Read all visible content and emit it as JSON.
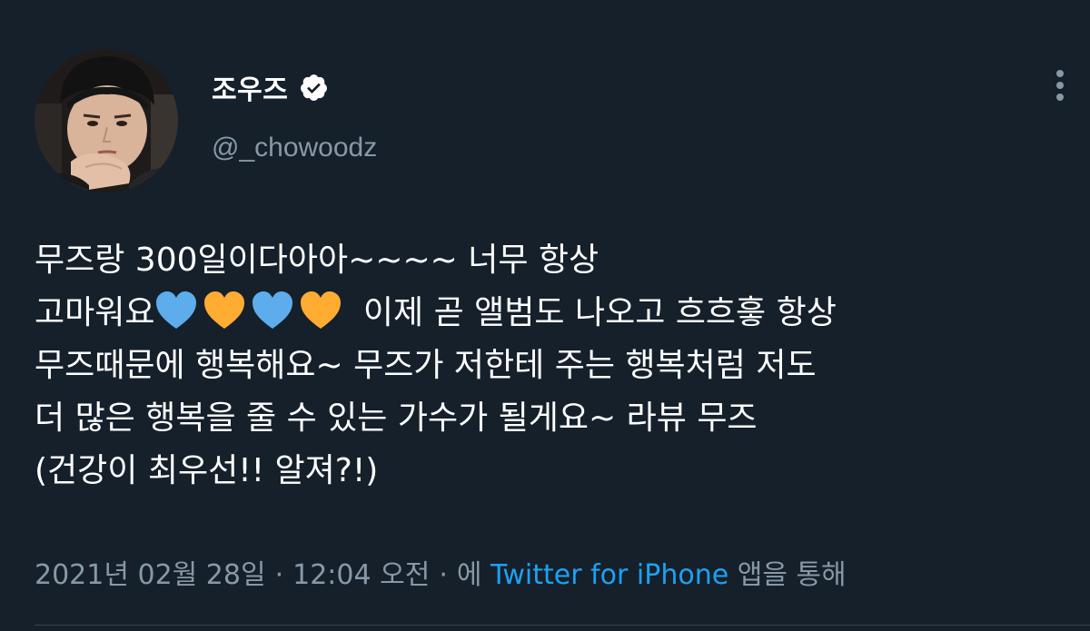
{
  "author": {
    "display_name": "조우즈",
    "handle": "@_chowoodz",
    "verified": true
  },
  "tweet": {
    "line1": "무즈랑 300일이다아아~~~~ 너무 항상",
    "line2_pre": "고마워요",
    "line2_post": " 이제 곧 앨범도 나오고 흐흐흫 항상",
    "line3": "무즈때문에 행복해요~ 무즈가 저한테 주는 행복처럼 저도",
    "line4": "더 많은 행복을 줄 수 있는 가수가 될게요~ 라뷰 무즈",
    "line5": "(건강이 최우선!! 알져?!)",
    "emojis": [
      "blue-heart",
      "yellow-heart",
      "blue-heart",
      "yellow-heart"
    ]
  },
  "meta": {
    "date": "2021년 02월 28일",
    "separator": "·",
    "time": "12:04 오전",
    "via_prefix": "에",
    "source": "Twitter for iPhone",
    "via_suffix": "앱을 통해"
  },
  "colors": {
    "background": "#15202b",
    "text": "#ffffff",
    "secondary": "#8899a6",
    "link": "#1da1f2",
    "blue_heart": "#5dadec",
    "yellow_heart": "#ffac33"
  }
}
